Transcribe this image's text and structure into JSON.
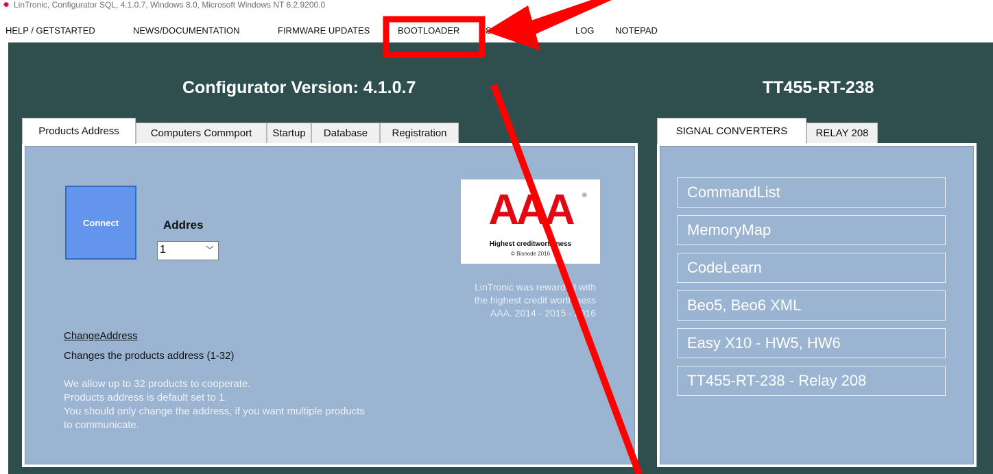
{
  "window": {
    "title": "LinTronic, Configurator SQL, 4.1.0.7, Windows 8.0, Microsoft Windows NT 6.2.9200.0"
  },
  "menu": {
    "items": [
      "HELP / GETSTARTED",
      "NEWS/DOCUMENTATION",
      "FIRMWARE UPDATES",
      "BOOTLOADER",
      "SAMPLER",
      "LOG",
      "NOTEPAD"
    ]
  },
  "header": {
    "configurator_version": "Configurator Version: 4.1.0.7",
    "device_title": "TT455-RT-238"
  },
  "left_tabs": [
    "Products Address",
    "Computers Commport",
    "Startup",
    "Database",
    "Registration"
  ],
  "products_address": {
    "connect_label": "Connect",
    "addres_label": "Addres",
    "addres_value": "1",
    "change_address_link": "ChangeAddress",
    "change_address_desc": "Changes the products address (1-32)",
    "info_lines": [
      "We allow up to 32 products to cooperate.",
      "Products address is default set to 1.",
      "You should only change the address, if you want multiple products",
      "to communicate."
    ],
    "aaa_logo": {
      "letters": "AAA",
      "registered": "®",
      "caption": "Highest creditworthiness",
      "credit": "© Bisnode 2016"
    },
    "award_lines": [
      "LinTronic was rewarded with",
      "the highest credit worthiness",
      "AAA. 2014 - 2015 - 2016"
    ]
  },
  "right_tabs": [
    "SIGNAL CONVERTERS",
    "RELAY 208"
  ],
  "signal_converters": {
    "buttons": [
      "CommandList",
      "MemoryMap",
      "CodeLearn",
      "Beo5, Beo6 XML",
      "Easy X10 - HW5, HW6",
      "TT455-RT-238 - Relay 208"
    ]
  },
  "colors": {
    "background": "#2f4f4f",
    "panel": "#9ab4d2",
    "connect_button": "#6495ed",
    "annotation_red": "#ff0000"
  }
}
